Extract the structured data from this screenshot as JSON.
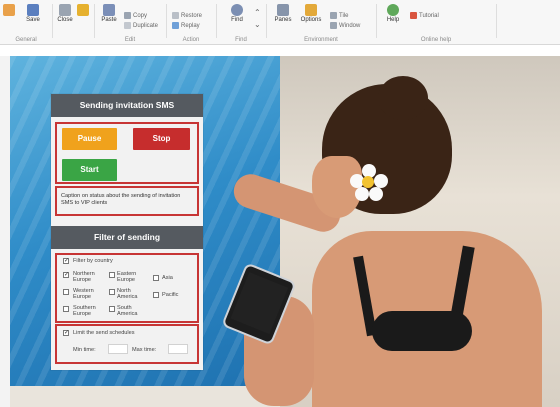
{
  "ribbon": {
    "groups": [
      {
        "label": "General",
        "buttons": [
          "Save",
          "Close"
        ]
      },
      {
        "label": "Edit",
        "buttons": [
          "Paste",
          "Copy",
          "Duplicate"
        ]
      },
      {
        "label": "Action",
        "buttons": [
          "Restore",
          "Replay"
        ]
      },
      {
        "label": "Find",
        "buttons": [
          "Find"
        ]
      },
      {
        "label": "Environment",
        "buttons": [
          "Panes",
          "Options",
          "Tile",
          "Window"
        ]
      },
      {
        "label": "Online help",
        "buttons": [
          "Help",
          "Tutorial"
        ]
      }
    ]
  },
  "panel": {
    "title": "Sending invitation SMS",
    "pause_label": "Pause",
    "stop_label": "Stop",
    "start_label": "Start",
    "caption": "Caption on status about the sending of invitation SMS to VIP clients",
    "filter_title": "Filter of sending",
    "filter_country_label": "Filter by country",
    "filter_country_checked": true,
    "countries": [
      {
        "name": "Northern Europe",
        "checked": true
      },
      {
        "name": "Eastern Europe",
        "checked": false
      },
      {
        "name": "Asia",
        "checked": false
      },
      {
        "name": "Western Europe",
        "checked": false
      },
      {
        "name": "North America",
        "checked": false
      },
      {
        "name": "Pacific",
        "checked": false
      },
      {
        "name": "Southern Europe",
        "checked": false
      },
      {
        "name": "South America",
        "checked": false
      }
    ],
    "limit_label": "Limit the send schedules",
    "limit_checked": true,
    "min_time_label": "Min time:",
    "max_time_label": "Max time:",
    "min_time_value": "",
    "max_time_value": ""
  },
  "colors": {
    "panel_header": "#555a60",
    "highlight_border": "#c73535",
    "pause": "#f0a21c",
    "stop": "#c62d2d",
    "start": "#3aa545",
    "pool": "#2f8cc8"
  }
}
